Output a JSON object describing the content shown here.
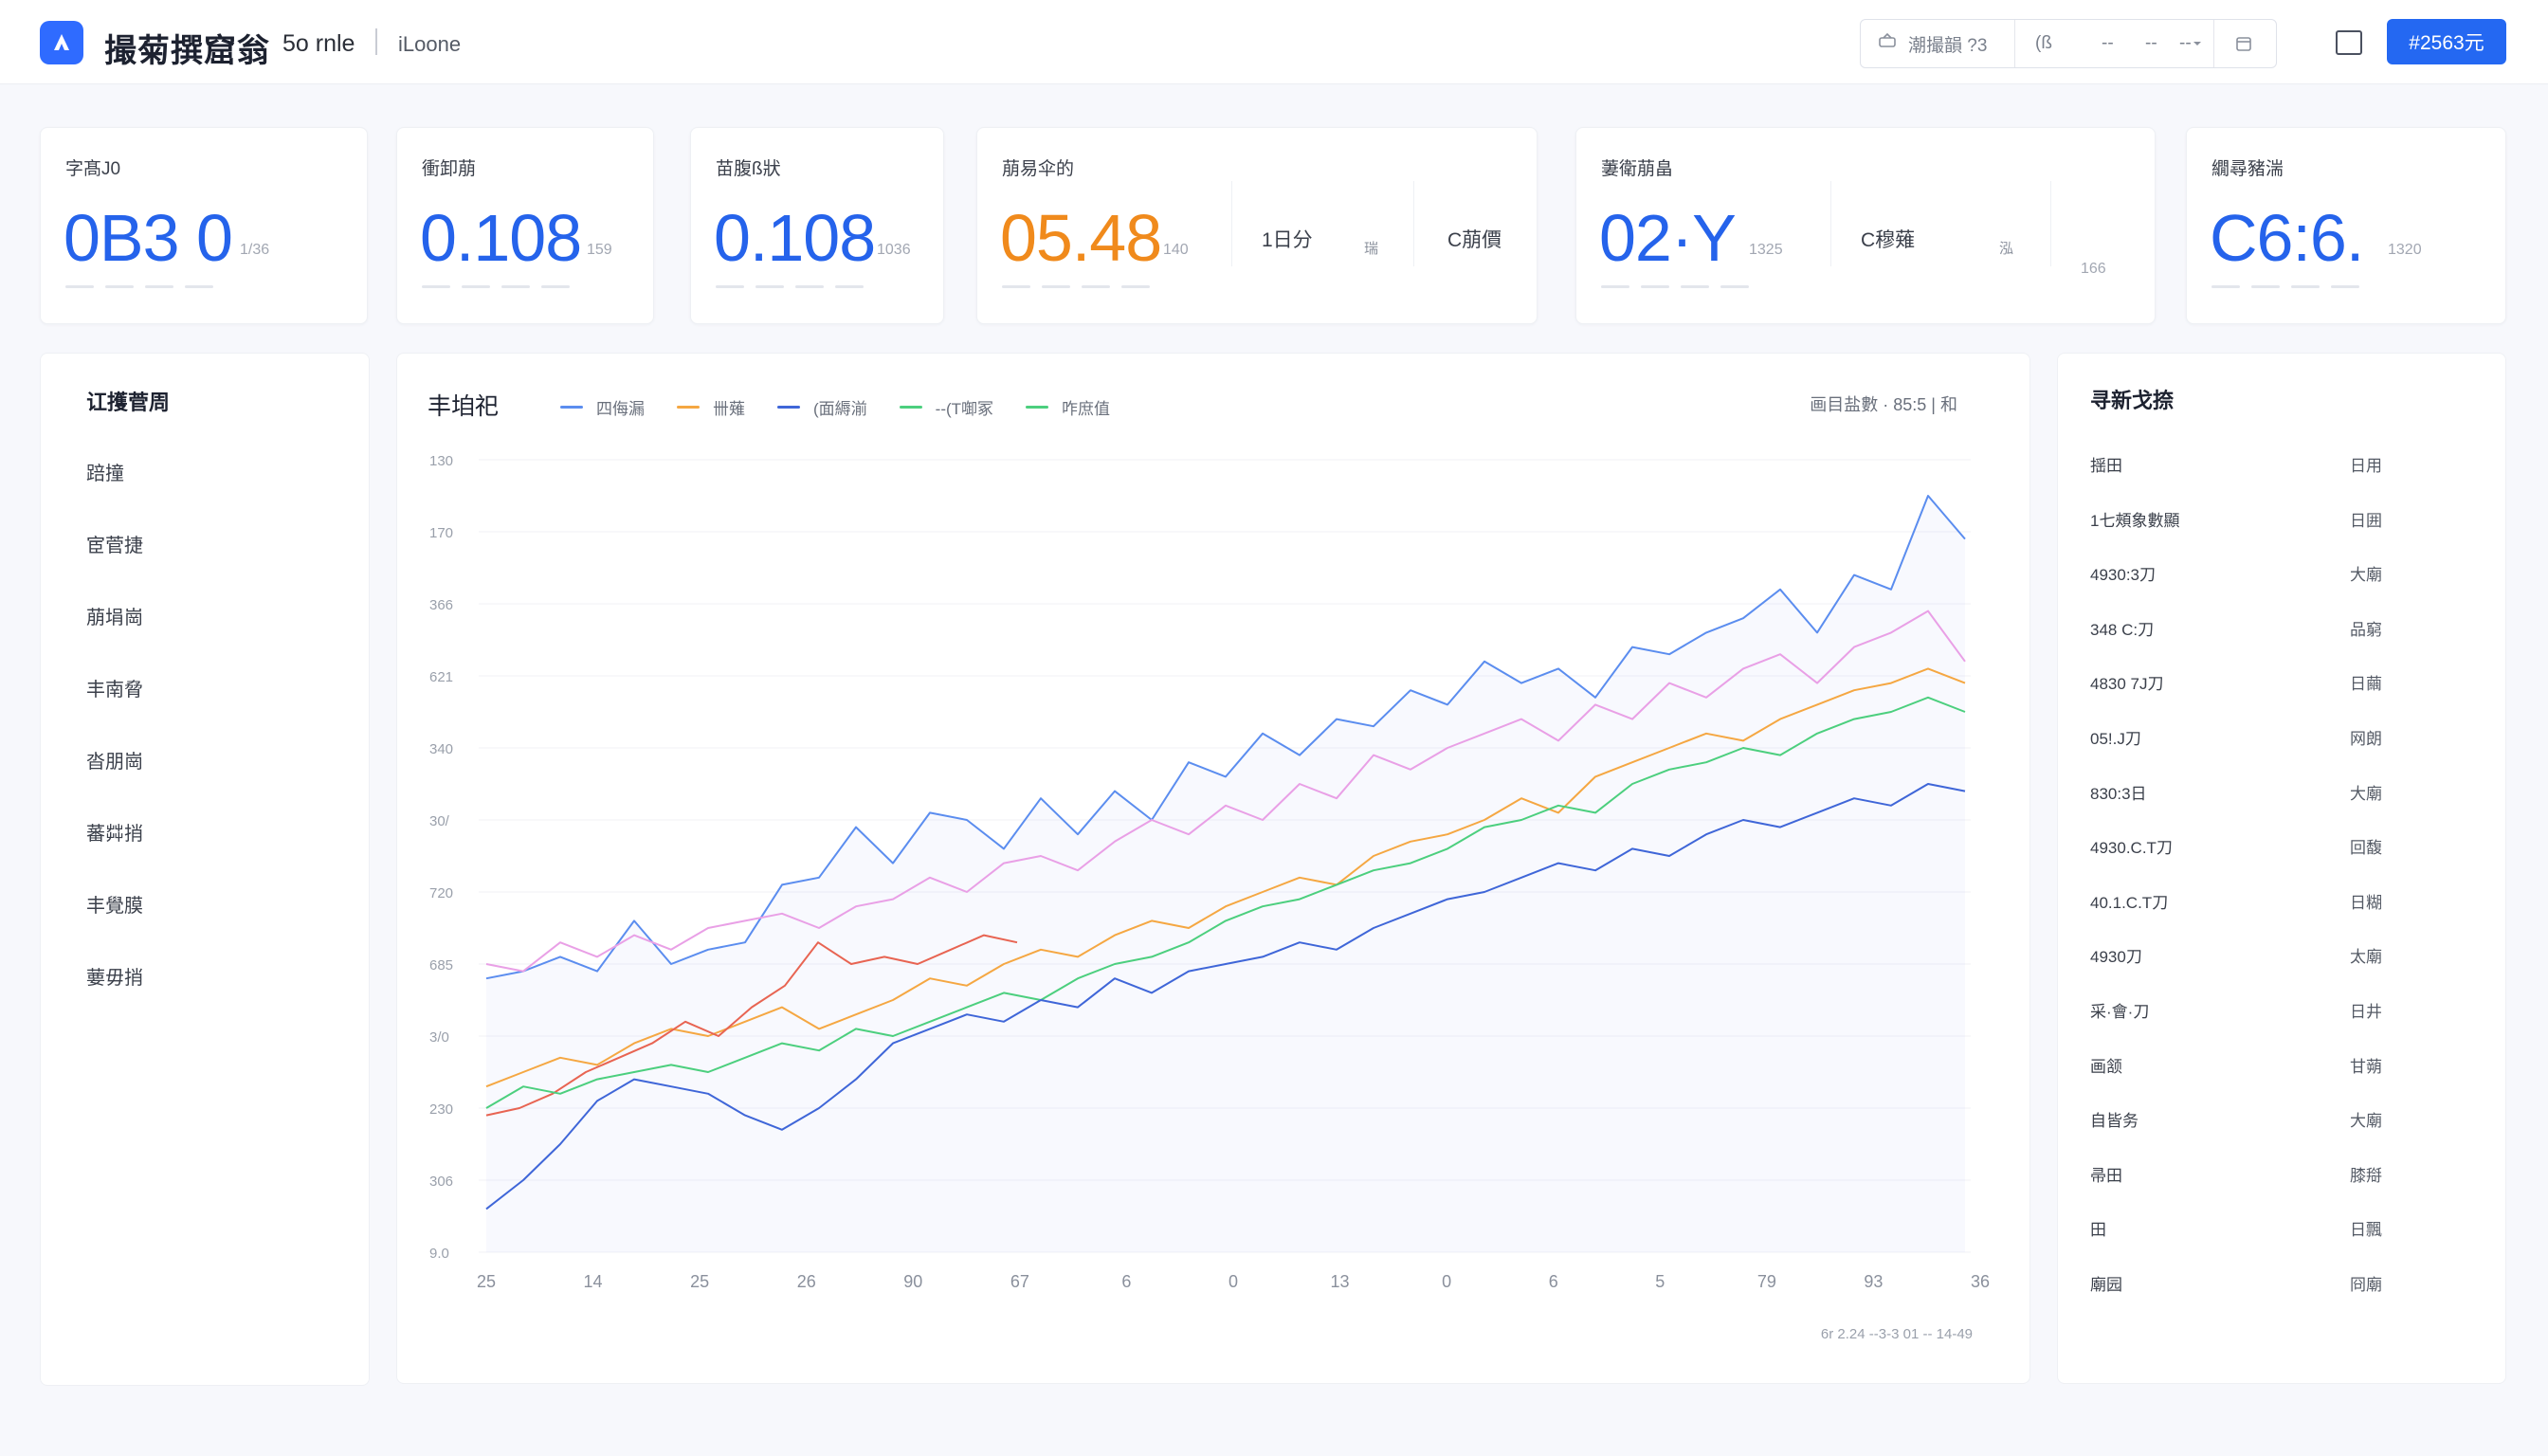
{
  "header": {
    "app_title": "撮菊撰窟翁",
    "subtitle": "5o rnle",
    "subtitle2": "iLoone",
    "toolbox": {
      "search_label": "潮撮韻 ?3",
      "item_a": "(ß",
      "item_b": "--",
      "item_c": "--",
      "item_d": "--"
    },
    "primary_button": "#2563元"
  },
  "stats": [
    {
      "label": "字髙J0",
      "value": "0B3 0",
      "small": "1/36"
    },
    {
      "label": "衝卸萠",
      "value": "0.108",
      "small": "159"
    },
    {
      "label": "苗腹ß狀",
      "value": "0.108",
      "small": "1036"
    },
    {
      "label": "萠易伞的",
      "value": "05.48",
      "small": "140",
      "mid1": "1日分",
      "mid2": "瑞",
      "mid3": "C萠價"
    },
    {
      "label": "萋衛萠畠",
      "value": "02·Y",
      "small": "1325",
      "mid1": "C穆薙",
      "mid2": "泓",
      "mid3": "166"
    },
    {
      "label": "繝尋豬湍",
      "value": "C6:6.",
      "small": "1320"
    }
  ],
  "sidebar": {
    "title": "讧擭菅周",
    "items": [
      "踣撞",
      "宦菅捷",
      "萠埍崗",
      "丰南脅",
      "沓朋崗",
      "蕃茻捎",
      "丰覺膜",
      "葽毋捎"
    ]
  },
  "chart": {
    "title": "丰垍祀",
    "legend": [
      "四侮漏",
      "卌薙",
      "(面縟湔",
      "--(T啣冢",
      "咋庶值"
    ],
    "right_label": "画目盐數 · 85:5 | 和",
    "footer": "6r 2.24    --3-3 01    --    14-49"
  },
  "chart_data": {
    "type": "line",
    "x": [
      "25",
      "14",
      "25",
      "26",
      "90",
      "67",
      "6",
      "0",
      "13",
      "0",
      "6",
      "5",
      "79",
      "93",
      "36"
    ],
    "y_ticks": [
      "130",
      "170",
      "366",
      "621",
      "340",
      "30/",
      "720",
      "685",
      "3/0",
      "230",
      "306",
      "9.0"
    ],
    "ylim": [
      0,
      11
    ],
    "series": [
      {
        "name": "四侮漏",
        "color": "#5b8def",
        "values": [
          3.8,
          3.9,
          4.1,
          3.9,
          4.6,
          4.0,
          4.2,
          4.3,
          5.1,
          5.2,
          5.9,
          5.4,
          6.1,
          6.0,
          5.6,
          6.3,
          5.8,
          6.4,
          6.0,
          6.8,
          6.6,
          7.2,
          6.9,
          7.4,
          7.3,
          7.8,
          7.6,
          8.2,
          7.9,
          8.1,
          7.7,
          8.4,
          8.3,
          8.6,
          8.8,
          9.2,
          8.6,
          9.4,
          9.2,
          10.5,
          9.9
        ]
      },
      {
        "name": "卌薙",
        "color": "#e9a0e6",
        "values": [
          4.0,
          3.9,
          4.3,
          4.1,
          4.4,
          4.2,
          4.5,
          4.6,
          4.7,
          4.5,
          4.8,
          4.9,
          5.2,
          5.0,
          5.4,
          5.5,
          5.3,
          5.7,
          6.0,
          5.8,
          6.2,
          6.0,
          6.5,
          6.3,
          6.9,
          6.7,
          7.0,
          7.2,
          7.4,
          7.1,
          7.6,
          7.4,
          7.9,
          7.7,
          8.1,
          8.3,
          7.9,
          8.4,
          8.6,
          8.9,
          8.2
        ]
      },
      {
        "name": "(面縟湔",
        "color": "#f5a742",
        "values": [
          2.3,
          2.5,
          2.7,
          2.6,
          2.9,
          3.1,
          3.0,
          3.2,
          3.4,
          3.1,
          3.3,
          3.5,
          3.8,
          3.7,
          4.0,
          4.2,
          4.1,
          4.4,
          4.6,
          4.5,
          4.8,
          5.0,
          5.2,
          5.1,
          5.5,
          5.7,
          5.8,
          6.0,
          6.3,
          6.1,
          6.6,
          6.8,
          7.0,
          7.2,
          7.1,
          7.4,
          7.6,
          7.8,
          7.9,
          8.1,
          7.9
        ]
      },
      {
        "name": "--(T啣冢",
        "color": "#e86452",
        "values": [
          1.9,
          2.0,
          2.2,
          2.5,
          2.7,
          2.9,
          3.2,
          3.0,
          3.4,
          3.7,
          4.3,
          4.0,
          4.1,
          4.0,
          4.2,
          4.4,
          4.3
        ]
      },
      {
        "name": "咋庶值",
        "color": "#4ccf7e",
        "values": [
          2.0,
          2.3,
          2.2,
          2.4,
          2.5,
          2.6,
          2.5,
          2.7,
          2.9,
          2.8,
          3.1,
          3.0,
          3.2,
          3.4,
          3.6,
          3.5,
          3.8,
          4.0,
          4.1,
          4.3,
          4.6,
          4.8,
          4.9,
          5.1,
          5.3,
          5.4,
          5.6,
          5.9,
          6.0,
          6.2,
          6.1,
          6.5,
          6.7,
          6.8,
          7.0,
          6.9,
          7.2,
          7.4,
          7.5,
          7.7,
          7.5
        ]
      },
      {
        "name": "",
        "color": "#3f66d8",
        "values": [
          0.6,
          1.0,
          1.5,
          2.1,
          2.4,
          2.3,
          2.2,
          1.9,
          1.7,
          2.0,
          2.4,
          2.9,
          3.1,
          3.3,
          3.2,
          3.5,
          3.4,
          3.8,
          3.6,
          3.9,
          4.0,
          4.1,
          4.3,
          4.2,
          4.5,
          4.7,
          4.9,
          5.0,
          5.2,
          5.4,
          5.3,
          5.6,
          5.5,
          5.8,
          6.0,
          5.9,
          6.1,
          6.3,
          6.2,
          6.5,
          6.4
        ]
      }
    ]
  },
  "right_panel": {
    "title": "寻新戈捺",
    "rows": [
      {
        "k": "揺田",
        "v": "日用"
      },
      {
        "k": "1七頰象數顯",
        "v": "日囲"
      },
      {
        "k": "4930:3刀",
        "v": "大廟"
      },
      {
        "k": "348 C:刀",
        "v": "品窮"
      },
      {
        "k": "4830 7J刀",
        "v": "日繭"
      },
      {
        "k": "05!.J刀",
        "v": "网朗"
      },
      {
        "k": "830:3日",
        "v": "大廟"
      },
      {
        "k": "4930.C.T刀",
        "v": "回馥"
      },
      {
        "k": "40.1.C.T刀",
        "v": "日糊"
      },
      {
        "k": "4930刀",
        "v": "太廟"
      },
      {
        "k": "采·會·刀",
        "v": "日井"
      },
      {
        "k": "画颔",
        "v": "甘蒴"
      },
      {
        "k": "自皆务",
        "v": "大廟"
      },
      {
        "k": "帚田",
        "v": "膝搿"
      },
      {
        "k": "田",
        "v": "日飄"
      },
      {
        "k": "廟园",
        "v": "冏廟"
      }
    ]
  }
}
